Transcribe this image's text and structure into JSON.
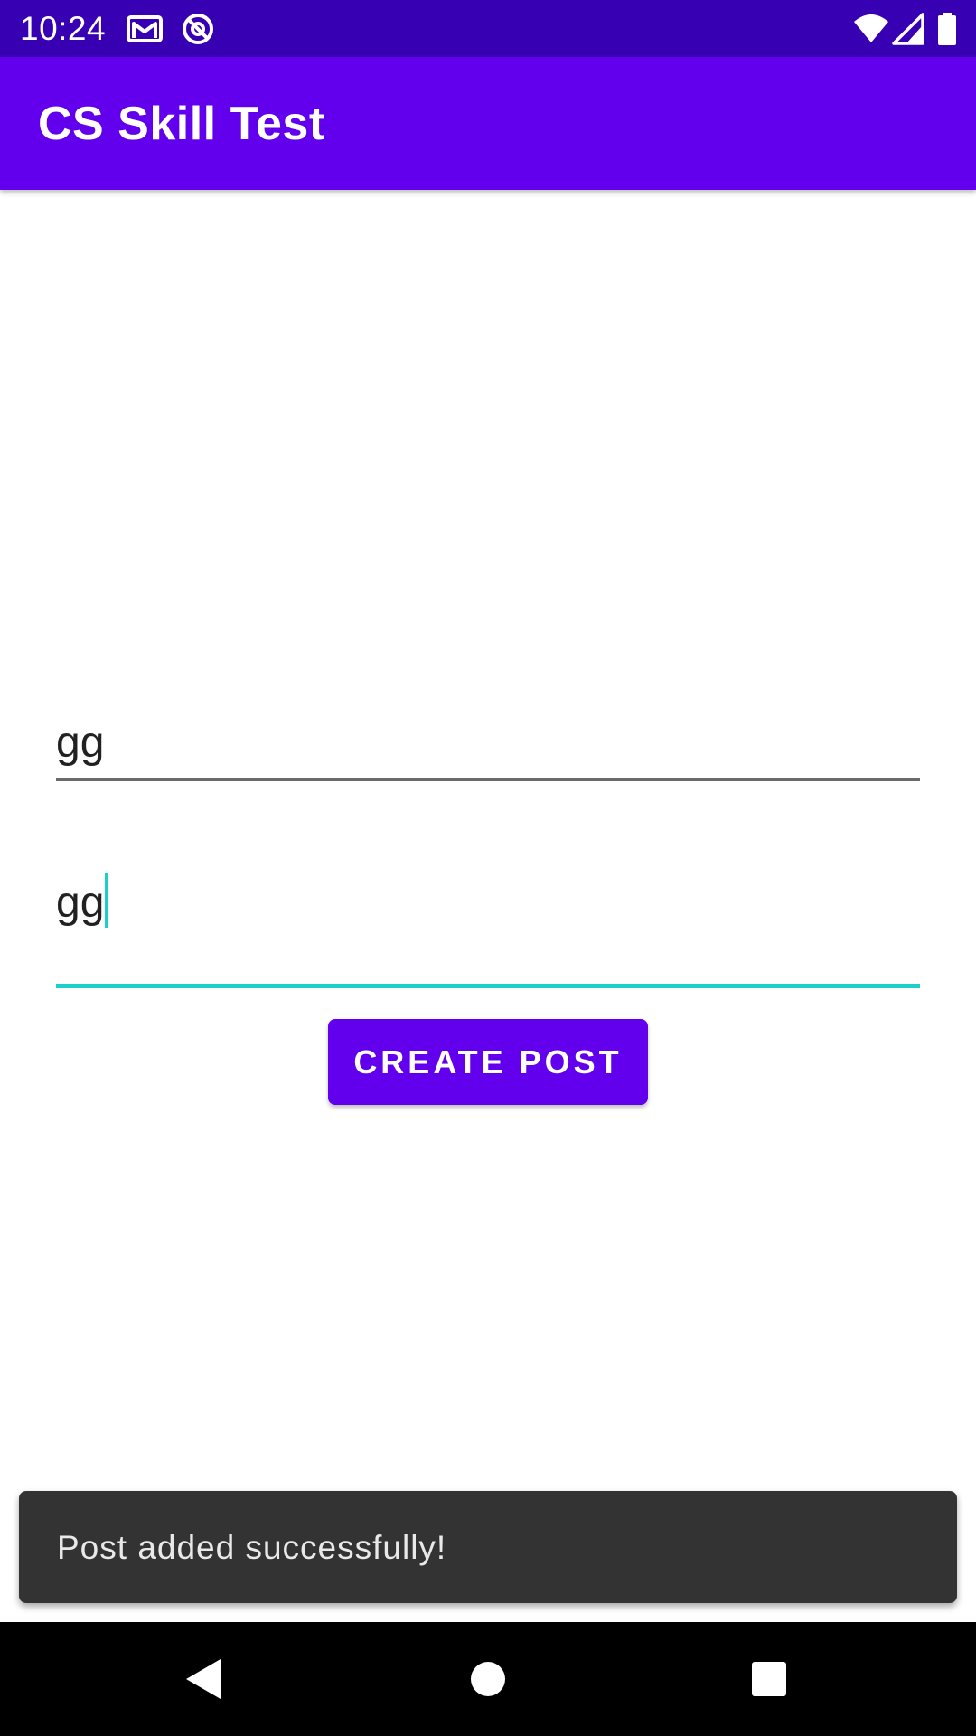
{
  "status_bar": {
    "time": "10:24",
    "icons": [
      "gmail-icon",
      "sync-icon",
      "wifi-icon",
      "signal-icon",
      "battery-icon"
    ]
  },
  "app_bar": {
    "title": "CS Skill Test"
  },
  "form": {
    "title_field_value": "gg",
    "body_field_value": "gg",
    "create_button_label": "CREATE POST"
  },
  "snackbar": {
    "message": "Post added successfully!"
  },
  "nav_bar": {
    "icons": [
      "back-icon",
      "home-icon",
      "recents-icon"
    ]
  },
  "colors": {
    "status_bar": "#3700b3",
    "primary": "#6200ee",
    "focus_accent": "#1ccfc9",
    "snackbar": "#333333"
  }
}
